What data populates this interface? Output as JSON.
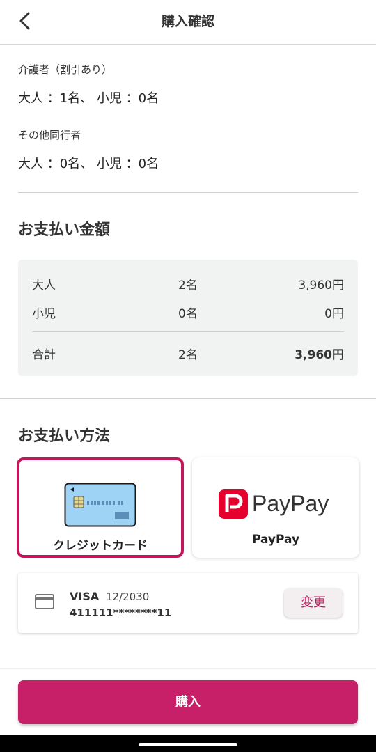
{
  "header": {
    "title": "購入確認"
  },
  "caregiver": {
    "label": "介護者（割引あり）",
    "counts": "大人 ：1名、 小児 ：0名"
  },
  "companions": {
    "label": "その他同行者",
    "counts": "大人 ：0名、 小児 ：0名"
  },
  "amount": {
    "title": "お支払い金額",
    "rows": [
      {
        "type": "大人",
        "count": "2名",
        "price": "3,960円"
      },
      {
        "type": "小児",
        "count": "0名",
        "price": "0円"
      }
    ],
    "total": {
      "type": "合計",
      "count": "2名",
      "price": "3,960円"
    }
  },
  "payment": {
    "title": "お支払い方法",
    "methods": [
      {
        "name": "クレジットカード",
        "selected": true
      },
      {
        "name": "PayPay",
        "selected": false
      }
    ],
    "paypay_logo_text": "PayPay",
    "paypay_logo_mark": "P"
  },
  "card": {
    "brand": "VISA",
    "expiry": "12/2030",
    "number": "411111********11",
    "change_label": "変更"
  },
  "purchase": {
    "label": "購入"
  },
  "colors": {
    "accent": "#c81f69",
    "selected_border": "#c2185b",
    "paypay_red": "#e6002d",
    "card_blue": "#9fd3f5"
  }
}
